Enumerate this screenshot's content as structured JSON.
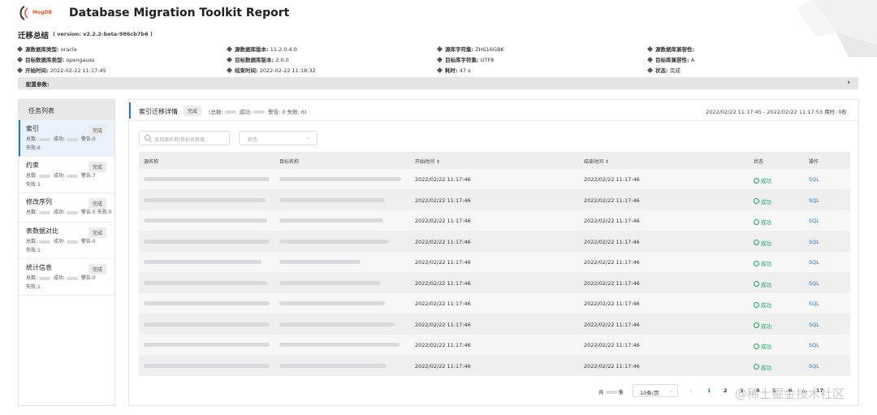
{
  "header": {
    "logo_text": "MogDB",
    "title": "Database Migration Toolkit Report"
  },
  "summary": {
    "title": "迁移总结",
    "version": "( version: v2.2.2-beta-986cb7b6 )",
    "rows": [
      [
        {
          "k": "源数据库类型:",
          "v": "oracle"
        },
        {
          "k": "源数据库版本:",
          "v": "11.2.0.4.0"
        },
        {
          "k": "源库字符集:",
          "v": "ZHS16GBK"
        },
        {
          "k": "源数据库兼容性:",
          "v": ""
        }
      ],
      [
        {
          "k": "目标数据库类型:",
          "v": "opengauss"
        },
        {
          "k": "目标数据库版本:",
          "v": "2.0.0"
        },
        {
          "k": "目标库字符集:",
          "v": "UTF8"
        },
        {
          "k": "目标库兼容性:",
          "v": "A"
        }
      ],
      [
        {
          "k": "开始时间:",
          "v": "2022-02-22 11:17:45"
        },
        {
          "k": "结束时间:",
          "v": "2022-02-22 11:18:32"
        },
        {
          "k": "耗时:",
          "v": "47 s"
        },
        {
          "k": "状态:",
          "v": "完成"
        }
      ]
    ],
    "config_label": "配置参数:"
  },
  "sidebar": {
    "title": "任务列表",
    "tasks": [
      {
        "name": "索引",
        "badge": "完成",
        "l1": "总数:",
        "l2": "成功:",
        "l3": "警告:0",
        "l4": "失败:6"
      },
      {
        "name": "约束",
        "badge": "完成",
        "l1": "总数:",
        "l2": "成功:",
        "l3": "警告:7",
        "l4": "失败:1"
      },
      {
        "name": "修改序列",
        "badge": "完成",
        "l1": "总数:",
        "l2": "成功:",
        "l3": "警告:0",
        "l4": "失败:0"
      },
      {
        "name": "表数据对比",
        "badge": "完成",
        "l1": "总数:",
        "l2": "成功:",
        "l3": "警告:0",
        "l4": "失败:1"
      },
      {
        "name": "统计信息",
        "badge": "完成",
        "l1": "总数:",
        "l2": "成功:",
        "l3": "警告:0",
        "l4": "失败:1"
      }
    ]
  },
  "main": {
    "title": "索引迁移详情",
    "status": "完成",
    "stats_total": "(总数:",
    "stats_success": "成功:",
    "stats_warn": "警告: 0",
    "stats_fail": "失败: 6)",
    "time_range": "2022/02/22 11:17:45 - 2022/02/22 11:17:53 用时: 0秒",
    "search_placeholder": "支持源名称/目标名称搜",
    "status_filter_placeholder": "状态",
    "columns": [
      "源名称",
      "目标名称",
      "开始时间 ⇕",
      "结束时间 ⇕",
      "状态",
      "操作"
    ],
    "rows": [
      {
        "start": "2022/02/22 11:17:46",
        "end": "2022/02/22 11:17:46",
        "status": "成功",
        "action": "SQL"
      },
      {
        "start": "2022/02/22 11:17:46",
        "end": "2022/02/22 11:17:46",
        "status": "成功",
        "action": "SQL"
      },
      {
        "start": "2022/02/22 11:17:46",
        "end": "2022/02/22 11:17:46",
        "status": "成功",
        "action": "SQL"
      },
      {
        "start": "2022/02/22 11:17:46",
        "end": "2022/02/22 11:17:46",
        "status": "成功",
        "action": "SQL"
      },
      {
        "start": "2022/02/22 11:17:46",
        "end": "2022/02/22 11:17:46",
        "status": "成功",
        "action": "SQL"
      },
      {
        "start": "2022/02/22 11:17:46",
        "end": "2022/02/22 11:17:46",
        "status": "成功",
        "action": "SQL"
      },
      {
        "start": "2022/02/22 11:17:46",
        "end": "2022/02/22 11:17:46",
        "status": "成功",
        "action": "SQL"
      },
      {
        "start": "2022/02/22 11:17:46",
        "end": "2022/02/22 11:17:46",
        "status": "成功",
        "action": "SQL"
      },
      {
        "start": "2022/02/22 11:17:46",
        "end": "2022/02/22 11:17:46",
        "status": "成功",
        "action": "SQL"
      },
      {
        "start": "2022/02/22 11:17:46",
        "end": "2022/02/22 11:17:46",
        "status": "成功",
        "action": "SQL"
      }
    ],
    "pager": {
      "total_prefix": "共",
      "total_suffix": "条",
      "page_size": "10条/页",
      "prev": "‹",
      "pages": [
        "1",
        "2",
        "3",
        "4",
        "5",
        "6",
        "..."
      ],
      "next": "17"
    }
  },
  "watermark": "@稀土掘金技术社区",
  "colors": {
    "accent": "#1d7bd6",
    "success": "#1aa35c",
    "brand": "#e8582a"
  }
}
